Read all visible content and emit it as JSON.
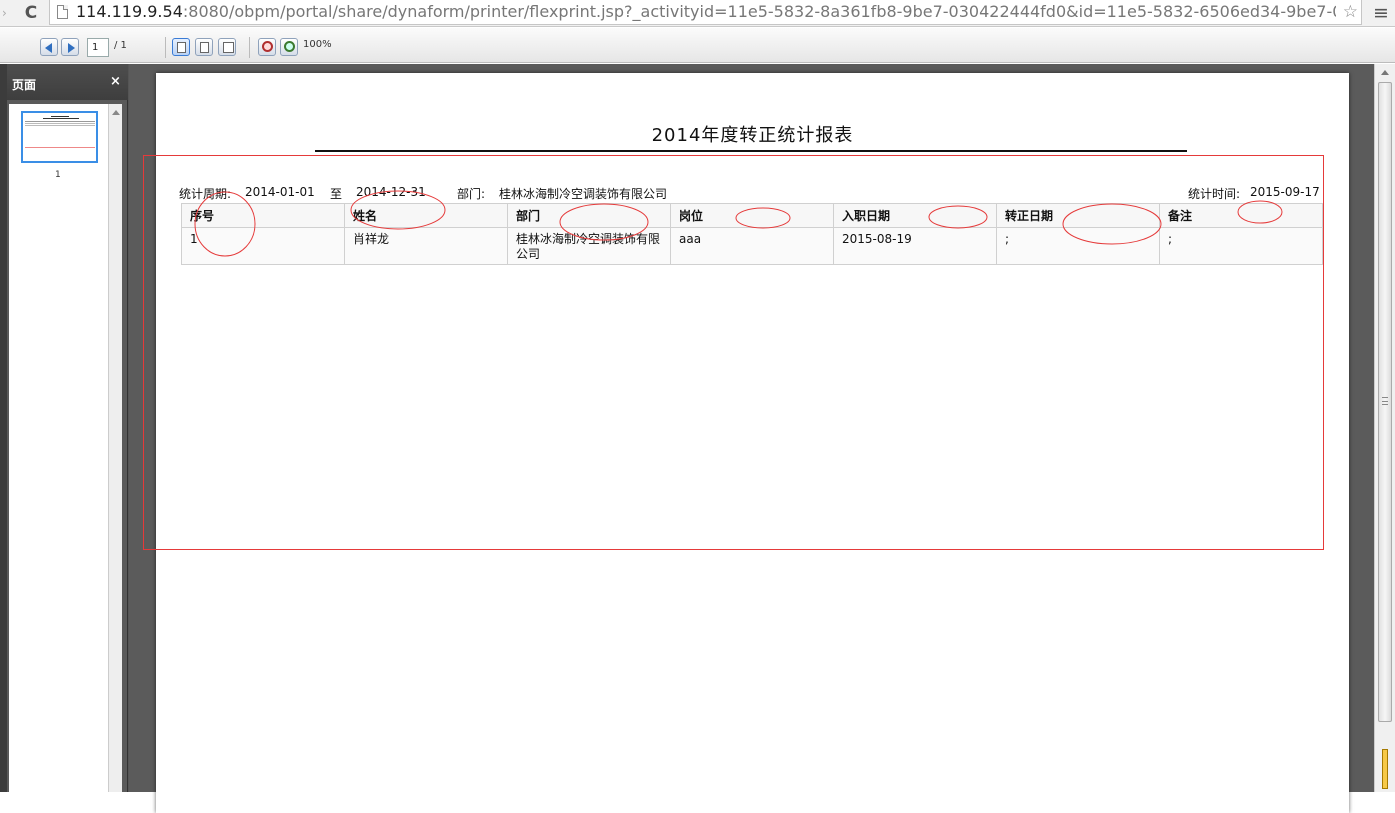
{
  "browser": {
    "url_host": "114.119.9.54",
    "url_rest": ":8080/obpm/portal/share/dynaform/printer/flexprint.jsp?_activityid=11e5-5832-8a361fb8-9be7-030422444fd0&id=11e5-5832-6506ed34-9be7-0304224",
    "back_glyph": "›",
    "reload_glyph": "C",
    "star_glyph": "☆",
    "menu_glyph": "≡"
  },
  "toolbar": {
    "page_current": "1",
    "page_total": "/ 1",
    "zoom": "100%"
  },
  "sidepanel": {
    "title": "页面",
    "close_glyph": "×",
    "thumb_label": "1"
  },
  "report": {
    "title": "2014年度转正统计报表",
    "period_label": "统计周期:",
    "period_start": "2014-01-01",
    "period_sep": "至",
    "period_end": "2014-12-31",
    "dept_label": "部门:",
    "dept_value": "桂林冰海制冷空调装饰有限公司",
    "time_label": "统计时间:",
    "time_value": "2015-09-17",
    "columns": [
      "序号",
      "姓名",
      "部门",
      "岗位",
      "入职日期",
      "转正日期",
      "备注"
    ],
    "rows": [
      [
        "1",
        "肖祥龙",
        "桂林冰海制冷空调装饰有限公司",
        "aaa",
        "2015-08-19",
        ";",
        ";"
      ]
    ]
  },
  "annotation_color": "#e53a3a"
}
